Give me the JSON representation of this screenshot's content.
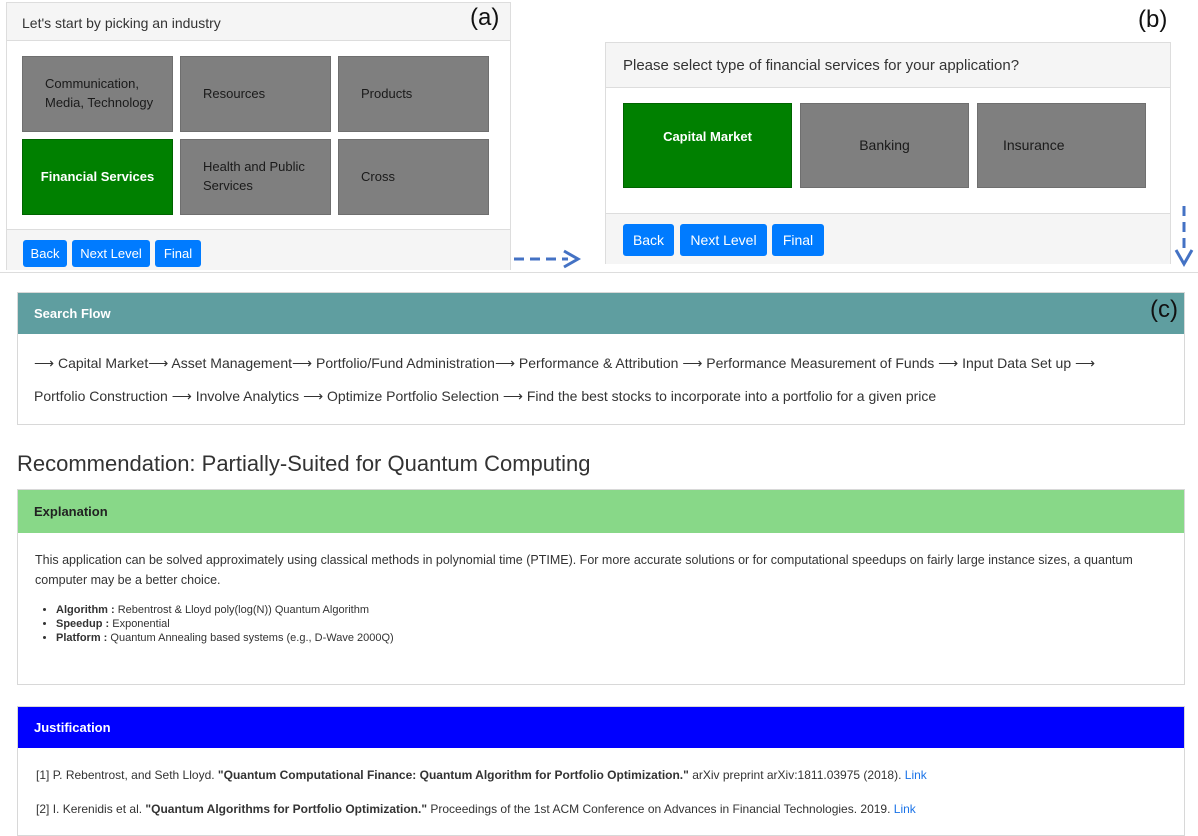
{
  "panel_a": {
    "tag": "(a)",
    "header": "Let's start by picking an industry",
    "tiles": [
      "Communication, Media, Technology",
      "Resources",
      "Products",
      "Financial Services",
      "Health and Public Services",
      "Cross"
    ],
    "selected": "Financial Services",
    "buttons": {
      "back": "Back",
      "next": "Next Level",
      "final": "Final"
    }
  },
  "panel_b": {
    "tag": "(b)",
    "header": "Please select type of financial services for your application?",
    "tiles": [
      "Capital Market",
      "Banking",
      "Insurance"
    ],
    "selected": "Capital Market",
    "buttons": {
      "back": "Back",
      "next": "Next Level",
      "final": "Final"
    }
  },
  "search_flow": {
    "tag": "(c)",
    "title": "Search Flow",
    "line1": "⟶ Capital Market⟶ Asset Management⟶ Portfolio/Fund Administration⟶ Performance & Attribution ⟶ Performance Measurement of Funds ⟶ Input Data Set up ⟶",
    "line2": "Portfolio Construction ⟶ Involve Analytics ⟶ Optimize Portfolio Selection ⟶ Find the best stocks to incorporate into a portfolio for a given price"
  },
  "recommendation": "Recommendation: Partially-Suited for Quantum Computing",
  "explanation": {
    "title": "Explanation",
    "text": "This application can be solved approximately using classical methods in polynomial time (PTIME). For more accurate solutions or for computational speedups on fairly large instance sizes, a quantum computer may be a better choice.",
    "items": [
      {
        "key": "Algorithm :",
        "value": "Rebentrost & Lloyd poly(log(N)) Quantum Algorithm"
      },
      {
        "key": "Speedup :",
        "value": "Exponential"
      },
      {
        "key": "Platform :",
        "value": "Quantum Annealing based systems (e.g., D-Wave 2000Q)"
      }
    ]
  },
  "justification": {
    "title": "Justification",
    "refs": [
      {
        "num": "[1]",
        "authors": "P. Rebentrost, and Seth Lloyd.",
        "title": "\"Quantum Computational Finance: Quantum Algorithm for Portfolio Optimization.\"",
        "venue": "arXiv preprint arXiv:1811.03975 (2018).",
        "link": "Link"
      },
      {
        "num": "[2]",
        "authors": "I. Kerenidis et al.",
        "title": "\"Quantum Algorithms for Portfolio Optimization.\"",
        "venue": "Proceedings of the 1st ACM Conference on Advances in Financial Technologies. 2019.",
        "link": "Link"
      }
    ]
  },
  "colors": {
    "selected": "#008000",
    "tile": "#7f7f7f",
    "button": "#007bff",
    "flow_header": "#5f9ea0",
    "explanation_header": "#88d888",
    "justification_header": "#0000ff",
    "arrow": "#4472c4"
  }
}
